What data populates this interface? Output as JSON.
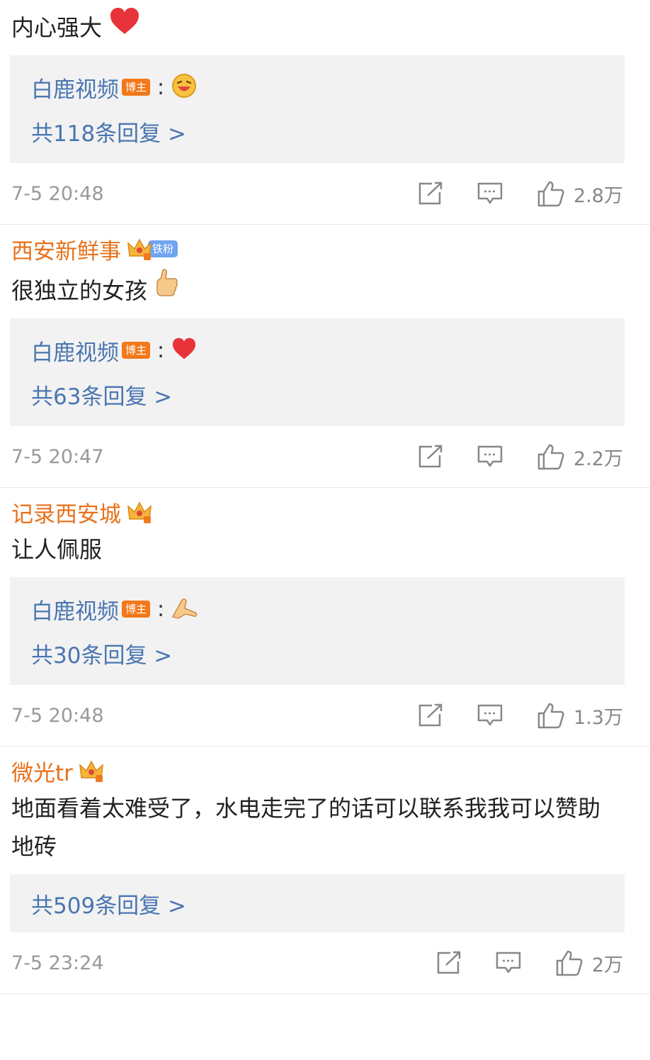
{
  "comments": [
    {
      "username": "",
      "text": "内心强大",
      "reply": {
        "blogger": "白鹿视频",
        "tag": "博主",
        "total": "共118条回复 >"
      },
      "time": "7-5 20:48",
      "likes": "2.8万"
    },
    {
      "username": "西安新鲜事",
      "fan_badge": "铁粉",
      "text": "很独立的女孩",
      "reply": {
        "blogger": "白鹿视频",
        "tag": "博主",
        "total": "共63条回复 >"
      },
      "time": "7-5 20:47",
      "likes": "2.2万"
    },
    {
      "username": "记录西安城",
      "text": "让人佩服",
      "reply": {
        "blogger": "白鹿视频",
        "tag": "博主",
        "total": "共30条回复 >"
      },
      "time": "7-5 20:48",
      "likes": "1.3万"
    },
    {
      "username": "微光tr",
      "text": "地面看着太难受了，水电走完了的话可以联系我我可以赞助地砖",
      "reply": {
        "total": "共509条回复 >"
      },
      "time": "7-5 23:24",
      "likes": "2万"
    }
  ],
  "colors": {
    "username": "#e8711b",
    "link": "#4a76b1",
    "reply_bg": "#f2f2f2",
    "meta": "#999999"
  },
  "icons": [
    "heart-emoji",
    "laugh-emoji",
    "thumbs-up-emoji",
    "pray-emoji",
    "crown-icon",
    "share-icon",
    "comment-icon",
    "like-icon"
  ]
}
